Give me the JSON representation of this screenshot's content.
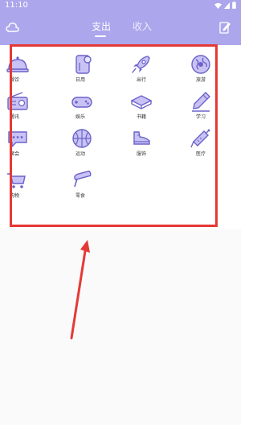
{
  "status_bar": {
    "time": "11:10"
  },
  "header": {
    "tabs": [
      {
        "label": "支出",
        "active": true
      },
      {
        "label": "收入",
        "active": false
      }
    ]
  },
  "categories": [
    {
      "label": "餐饮",
      "icon": "dining-cloche-icon"
    },
    {
      "label": "日用",
      "icon": "paper-roll-icon"
    },
    {
      "label": "出行",
      "icon": "rocket-icon"
    },
    {
      "label": "旅游",
      "icon": "globe-icon"
    },
    {
      "label": "通讯",
      "icon": "radio-icon"
    },
    {
      "label": "娱乐",
      "icon": "gamepad-icon"
    },
    {
      "label": "书籍",
      "icon": "book-icon"
    },
    {
      "label": "学习",
      "icon": "pen-icon"
    },
    {
      "label": "聚会",
      "icon": "chat-bubble-icon"
    },
    {
      "label": "运动",
      "icon": "basketball-icon"
    },
    {
      "label": "服饰",
      "icon": "sneaker-icon"
    },
    {
      "label": "医疗",
      "icon": "syringe-icon"
    },
    {
      "label": "购物",
      "icon": "shopping-cart-icon"
    },
    {
      "label": "零食",
      "icon": "popsicle-icon"
    }
  ],
  "colors": {
    "header_bg": "#aca6ec",
    "icon_fill": "#c9c3f5",
    "icon_stroke": "#6b63c9",
    "annotation_red": "#e53935"
  }
}
